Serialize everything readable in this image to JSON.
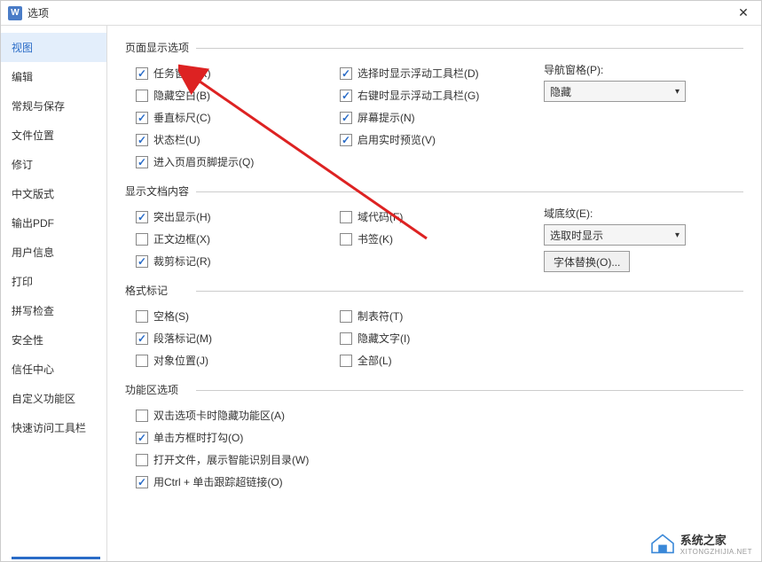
{
  "titlebar": {
    "title": "选项",
    "icon_text": "W"
  },
  "sidebar": {
    "items": [
      {
        "label": "视图",
        "active": true
      },
      {
        "label": "编辑"
      },
      {
        "label": "常规与保存"
      },
      {
        "label": "文件位置"
      },
      {
        "label": "修订"
      },
      {
        "label": "中文版式"
      },
      {
        "label": "输出PDF"
      },
      {
        "label": "用户信息"
      },
      {
        "label": "打印"
      },
      {
        "label": "拼写检查"
      },
      {
        "label": "安全性"
      },
      {
        "label": "信任中心"
      },
      {
        "label": "自定义功能区"
      },
      {
        "label": "快速访问工具栏"
      }
    ]
  },
  "sections": {
    "page_display": {
      "title": "页面显示选项",
      "col1": [
        {
          "label": "任务窗格(R)",
          "checked": true
        },
        {
          "label": "隐藏空白(B)",
          "checked": false
        },
        {
          "label": "垂直标尺(C)",
          "checked": true
        },
        {
          "label": "状态栏(U)",
          "checked": true
        },
        {
          "label": "进入页眉页脚提示(Q)",
          "checked": true
        }
      ],
      "col2": [
        {
          "label": "选择时显示浮动工具栏(D)",
          "checked": true
        },
        {
          "label": "右键时显示浮动工具栏(G)",
          "checked": true
        },
        {
          "label": "屏幕提示(N)",
          "checked": true
        },
        {
          "label": "启用实时预览(V)",
          "checked": true
        }
      ],
      "nav_pane": {
        "label": "导航窗格(P):",
        "value": "隐藏"
      }
    },
    "doc_content": {
      "title": "显示文档内容",
      "col1": [
        {
          "label": "突出显示(H)",
          "checked": true
        },
        {
          "label": "正文边框(X)",
          "checked": false
        },
        {
          "label": "裁剪标记(R)",
          "checked": true
        }
      ],
      "col2": [
        {
          "label": "域代码(F)",
          "checked": false
        },
        {
          "label": "书签(K)",
          "checked": false
        }
      ],
      "field_shading": {
        "label": "域底纹(E):",
        "value": "选取时显示"
      },
      "font_replace_btn": "字体替换(O)..."
    },
    "format_marks": {
      "title": "格式标记",
      "col1": [
        {
          "label": "空格(S)",
          "checked": false
        },
        {
          "label": "段落标记(M)",
          "checked": true
        },
        {
          "label": "对象位置(J)",
          "checked": false
        }
      ],
      "col2": [
        {
          "label": "制表符(T)",
          "checked": false
        },
        {
          "label": "隐藏文字(I)",
          "checked": false
        },
        {
          "label": "全部(L)",
          "checked": false
        }
      ]
    },
    "ribbon": {
      "title": "功能区选项",
      "items": [
        {
          "label": "双击选项卡时隐藏功能区(A)",
          "checked": false
        },
        {
          "label": "单击方框时打勾(O)",
          "checked": true
        },
        {
          "label": "打开文件，展示智能识别目录(W)",
          "checked": false
        },
        {
          "label": "用Ctrl + 单击跟踪超链接(O)",
          "checked": true
        }
      ]
    }
  },
  "watermark": {
    "main": "系统之家",
    "sub": "XITONGZHIJIA.NET"
  }
}
